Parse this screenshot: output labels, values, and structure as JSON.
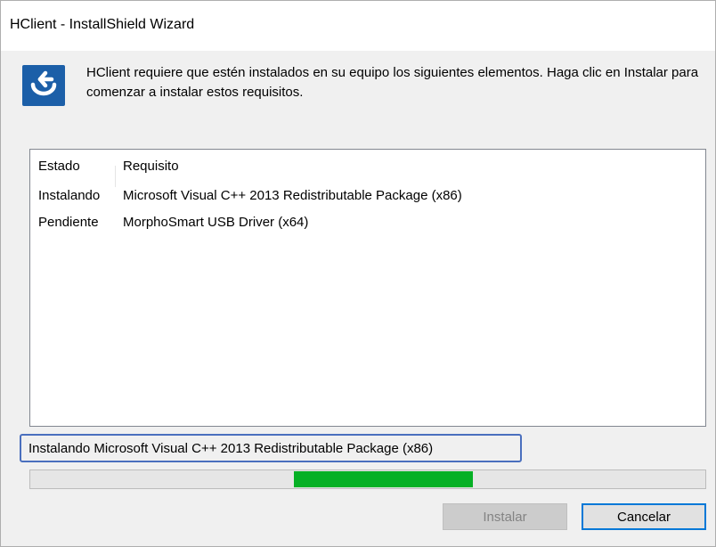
{
  "window": {
    "title": "HClient - InstallShield Wizard"
  },
  "header": {
    "icon": "installshield-logo-icon",
    "message": "HClient requiere que estén instalados en su equipo los siguientes elementos. Haga clic en Instalar para comenzar a instalar estos requisitos."
  },
  "requirements": {
    "columns": {
      "state": "Estado",
      "requirement": "Requisito"
    },
    "rows": [
      {
        "state": "Instalando",
        "requirement": "Microsoft Visual C++ 2013 Redistributable Package (x86)"
      },
      {
        "state": "Pendiente",
        "requirement": "MorphoSmart USB Driver (x64)"
      }
    ]
  },
  "status": {
    "text": "Instalando Microsoft Visual C++ 2013 Redistributable Package (x86)"
  },
  "progress": {
    "style": "marquee",
    "segment_start": 0.39,
    "segment_end": 0.655,
    "color": "#06b025"
  },
  "buttons": {
    "install_label": "Instalar",
    "install_enabled": false,
    "cancel_label": "Cancelar"
  },
  "colors": {
    "accent": "#0078d7",
    "icon_bg": "#1c5fa8",
    "status_highlight": "#4a6fbe"
  }
}
